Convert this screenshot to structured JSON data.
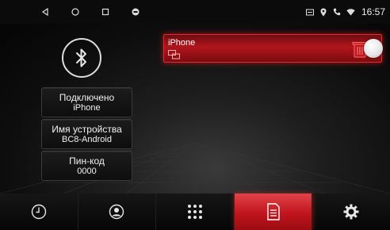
{
  "status_bar": {
    "nav_icons": [
      "back-icon",
      "home-icon",
      "recents-icon",
      "app-indicator-icon"
    ],
    "status_icons": [
      "sim-icon",
      "location-icon",
      "phone-icon",
      "wifi-icon"
    ],
    "time": "16:57"
  },
  "bluetooth": {
    "icon": "bluetooth-icon",
    "connected_label": "Подключено",
    "connected_device": "iPhone",
    "device_name_label": "Имя устройства",
    "device_name": "BC8-Android",
    "pin_label": "Пин-код",
    "pin": "0000"
  },
  "paired_device": {
    "name": "iPhone",
    "type_icon": "device-link-icon",
    "delete_icon": "trash-icon"
  },
  "bottom_tabs": [
    {
      "icon": "clock-icon",
      "active": false
    },
    {
      "icon": "contacts-icon",
      "active": false
    },
    {
      "icon": "dialpad-icon",
      "active": false
    },
    {
      "icon": "device-list-icon",
      "active": true
    },
    {
      "icon": "settings-icon",
      "active": false
    }
  ],
  "colors": {
    "accent_red": "#c1141c",
    "background": "#000000"
  }
}
